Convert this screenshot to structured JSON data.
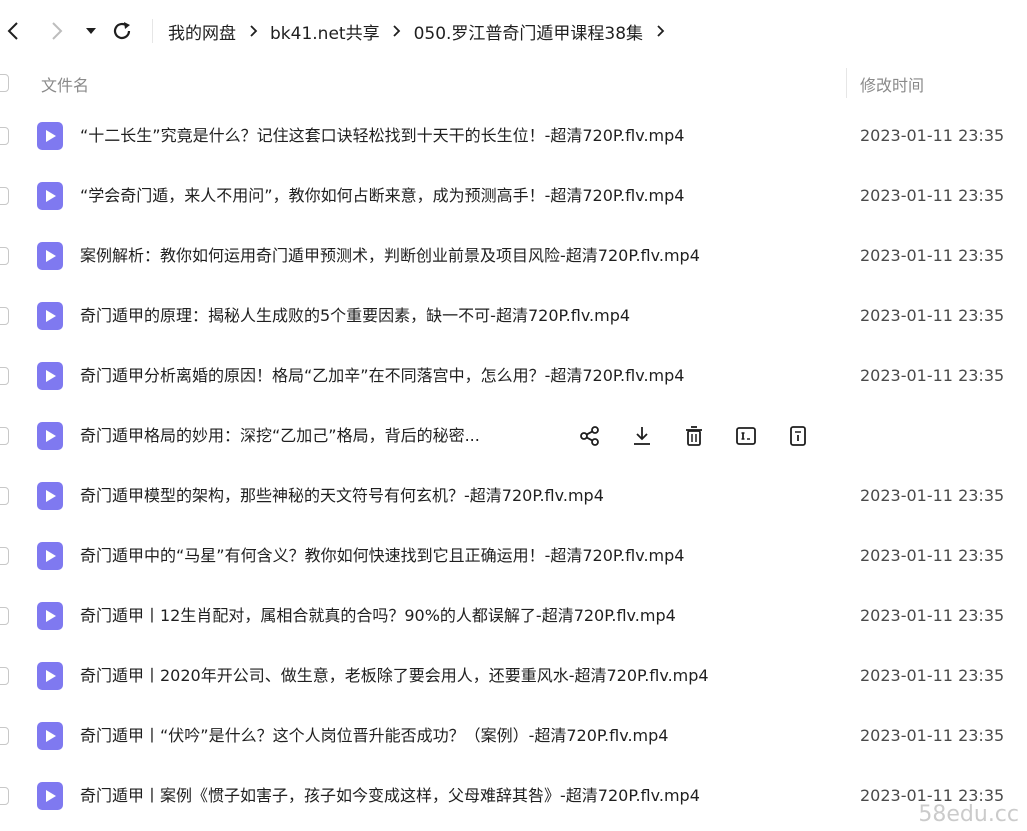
{
  "nav": {
    "breadcrumbs": [
      "我的网盘",
      "bk41.net共享",
      "050.罗江普奇门遁甲课程38集"
    ]
  },
  "header": {
    "name_label": "文件名",
    "time_label": "修改时间"
  },
  "files": [
    {
      "name": "“十二长生”究竟是什么？记住这套口诀轻松找到十天干的长生位！-超清720P.flv.mp4",
      "time": "2023-01-11 23:35"
    },
    {
      "name": "“学会奇门遁，来人不用问”，教你如何占断来意，成为预测高手！-超清720P.flv.mp4",
      "time": "2023-01-11 23:35"
    },
    {
      "name": "案例解析：教你如何运用奇门遁甲预测术，判断创业前景及项目风险-超清720P.flv.mp4",
      "time": "2023-01-11 23:35"
    },
    {
      "name": "奇门遁甲的原理：揭秘人生成败的5个重要因素，缺一不可-超清720P.flv.mp4",
      "time": "2023-01-11 23:35"
    },
    {
      "name": "奇门遁甲分析离婚的原因！格局“乙加辛”在不同落宫中，怎么用？-超清720P.flv.mp4",
      "time": "2023-01-11 23:35"
    },
    {
      "name": "奇门遁甲格局的妙用：深挖“乙加己”格局，背后的秘密...",
      "time": ""
    },
    {
      "name": "奇门遁甲模型的架构，那些神秘的天文符号有何玄机？-超清720P.flv.mp4",
      "time": "2023-01-11 23:35"
    },
    {
      "name": "奇门遁甲中的“马星”有何含义？教你如何快速找到它且正确运用！-超清720P.flv.mp4",
      "time": "2023-01-11 23:35"
    },
    {
      "name": "奇门遁甲丨12生肖配对，属相合就真的合吗？90%的人都误解了-超清720P.flv.mp4",
      "time": "2023-01-11 23:35"
    },
    {
      "name": "奇门遁甲丨2020年开公司、做生意，老板除了要会用人，还要重风水-超清720P.flv.mp4",
      "time": "2023-01-11 23:35"
    },
    {
      "name": "奇门遁甲丨“伏吟”是什么？这个人岗位晋升能否成功？（案例）-超清720P.flv.mp4",
      "time": "2023-01-11 23:35"
    },
    {
      "name": "奇门遁甲丨案例《惯子如害子，孩子如今变成这样，父母难辞其咎》-超清720P.flv.mp4",
      "time": "2023-01-11 23:35"
    }
  ],
  "hover_row_index": 5,
  "hover_actions": [
    "share-icon",
    "download-icon",
    "delete-icon",
    "rename-icon",
    "info-icon"
  ],
  "watermark": "58edu.cc",
  "colors": {
    "video_icon": "#7f79f0",
    "text": "#1f1f1f",
    "muted": "#8a8a8a"
  }
}
